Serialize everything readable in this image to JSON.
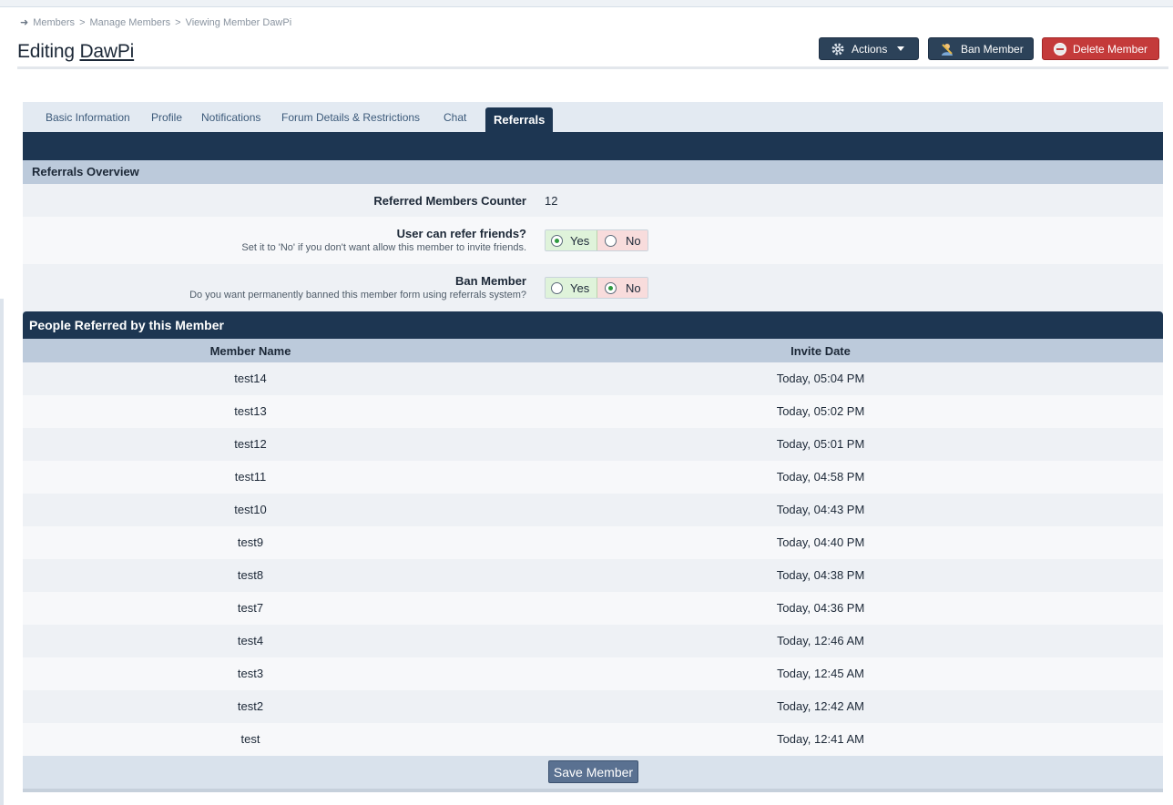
{
  "breadcrumb": {
    "items": [
      "Members",
      "Manage Members",
      "Viewing Member DawPi"
    ],
    "sep": ">"
  },
  "page": {
    "title_prefix": "Editing",
    "member_name": "DawPi"
  },
  "toolbar": {
    "actions_label": "Actions",
    "ban_label": "Ban Member",
    "delete_label": "Delete Member"
  },
  "tabs": [
    {
      "label": "Basic Information"
    },
    {
      "label": "Profile"
    },
    {
      "label": "Notifications"
    },
    {
      "label": "Forum Details & Restrictions"
    },
    {
      "label": "Chat"
    },
    {
      "label": "Referrals",
      "active": true
    }
  ],
  "overview": {
    "heading": "Referrals Overview",
    "counter_label": "Referred Members Counter",
    "counter_value": "12",
    "refer_label": "User can refer friends?",
    "refer_desc": "Set it to 'No' if you don't want allow this member to invite friends.",
    "refer_value": "Yes",
    "ban_label": "Ban Member",
    "ban_desc": "Do you want permanently banned this member form using referrals system?",
    "ban_value": "No",
    "yes_label": "Yes",
    "no_label": "No"
  },
  "referred": {
    "heading": "People Referred by this Member",
    "col_name": "Member Name",
    "col_date": "Invite Date",
    "rows": [
      {
        "name": "test14",
        "date": "Today, 05:04 PM"
      },
      {
        "name": "test13",
        "date": "Today, 05:02 PM"
      },
      {
        "name": "test12",
        "date": "Today, 05:01 PM"
      },
      {
        "name": "test11",
        "date": "Today, 04:58 PM"
      },
      {
        "name": "test10",
        "date": "Today, 04:43 PM"
      },
      {
        "name": "test9",
        "date": "Today, 04:40 PM"
      },
      {
        "name": "test8",
        "date": "Today, 04:38 PM"
      },
      {
        "name": "test7",
        "date": "Today, 04:36 PM"
      },
      {
        "name": "test4",
        "date": "Today, 12:46 AM"
      },
      {
        "name": "test3",
        "date": "Today, 12:45 AM"
      },
      {
        "name": "test2",
        "date": "Today, 12:42 AM"
      },
      {
        "name": "test",
        "date": "Today, 12:41 AM"
      }
    ]
  },
  "footer": {
    "save_label": "Save Member"
  },
  "colors": {
    "navy": "#1d3652",
    "subhead": "#bccadb",
    "danger": "#c43a3a",
    "yes_bg": "#dff3da",
    "no_bg": "#f8dcdc"
  }
}
